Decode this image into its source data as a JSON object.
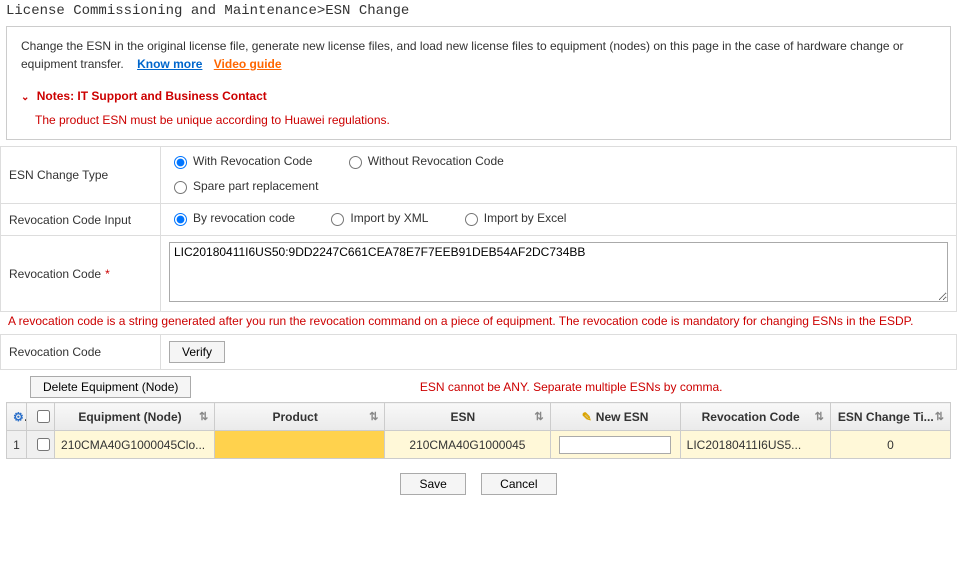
{
  "breadcrumb": "License Commissioning and Maintenance>ESN Change",
  "info": {
    "desc": "Change the ESN in the original license file, generate new license files, and load new license files to equipment (nodes) on this page in the case of hardware change or equipment transfer.",
    "know_more": "Know more",
    "video_guide": "Video guide",
    "notes_title": "Notes:  IT Support and Business Contact",
    "notes_body": "The product ESN must be unique according to Huawei regulations."
  },
  "form": {
    "change_type_label": "ESN Change Type",
    "change_type_opts": {
      "with_rev": "With Revocation Code",
      "without_rev": "Without Revocation Code",
      "spare": "Spare part replacement"
    },
    "rev_input_label": "Revocation Code Input",
    "rev_input_opts": {
      "by_code": "By revocation code",
      "by_xml": "Import by XML",
      "by_excel": "Import by Excel"
    },
    "rev_code_label": "Revocation Code",
    "rev_code_value": "LIC20180411I6US50:9DD2247C661CEA78E7F7EEB91DEB54AF2DC734BB",
    "rev_code_note": "A revocation code is a string generated after you run the revocation command on a piece of equipment. The revocation code is mandatory for changing ESNs in the ESDP.",
    "rev_code_verify_label": "Revocation Code",
    "verify_btn": "Verify"
  },
  "grid": {
    "delete_btn": "Delete Equipment (Node)",
    "esn_warn": "ESN cannot be ANY. Separate multiple ESNs by comma.",
    "cols": {
      "equipment": "Equipment (Node)",
      "product": "Product",
      "esn": "ESN",
      "new_esn": "New ESN",
      "rev_code": "Revocation Code",
      "change_times": "ESN Change Ti..."
    },
    "row": {
      "num": "1",
      "equipment": "210CMA40G1000045Clo...",
      "product": "",
      "esn": "210CMA40G1000045",
      "new_esn": "",
      "rev_code": "LIC20180411I6US5...",
      "change_times": "0"
    }
  },
  "buttons": {
    "save": "Save",
    "cancel": "Cancel"
  }
}
